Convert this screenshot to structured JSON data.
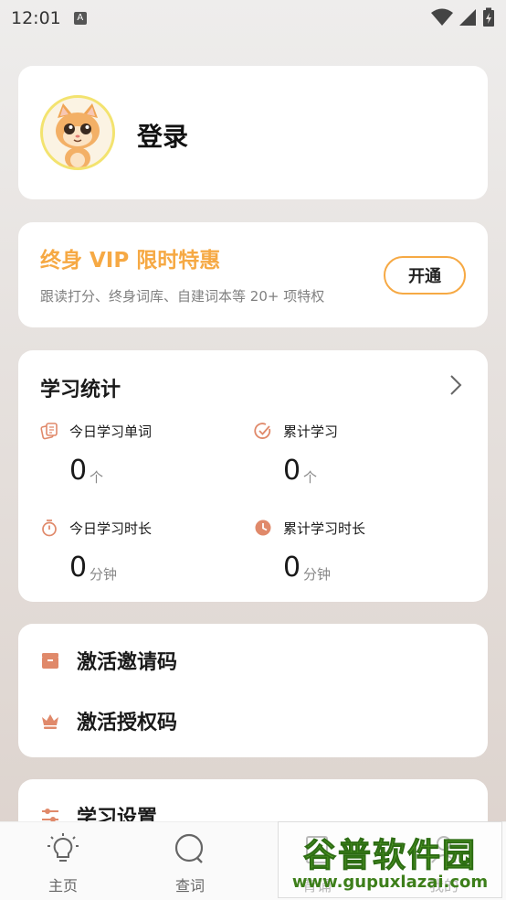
{
  "status_bar": {
    "time": "12:01",
    "a_icon": "A"
  },
  "login": {
    "label": "登录",
    "avatar_icon": "cat-avatar-icon"
  },
  "vip": {
    "title": "终身 VIP 限时特惠",
    "subtitle": "跟读打分、终身词库、自建词本等 20+ 项特权",
    "button": "开通",
    "accent": "#f6a944"
  },
  "stats": {
    "title": "学习统计",
    "items": [
      {
        "label": "今日学习单词",
        "value": "0",
        "unit": "个",
        "icon": "cards-icon"
      },
      {
        "label": "累计学习",
        "value": "0",
        "unit": "个",
        "icon": "check-circle-icon"
      },
      {
        "label": "今日学习时长",
        "value": "0",
        "unit": "分钟",
        "icon": "timer-icon"
      },
      {
        "label": "累计学习时长",
        "value": "0",
        "unit": "分钟",
        "icon": "clock-icon"
      }
    ]
  },
  "codes": {
    "invite": "激活邀请码",
    "license": "激活授权码"
  },
  "settings": {
    "label": "学习设置"
  },
  "nav": {
    "home": "主页",
    "search": "查词",
    "third": "背诵",
    "mine": "我的"
  },
  "watermark": {
    "top": "谷普软件园",
    "bottom": "www.gupuxlazai.com"
  }
}
